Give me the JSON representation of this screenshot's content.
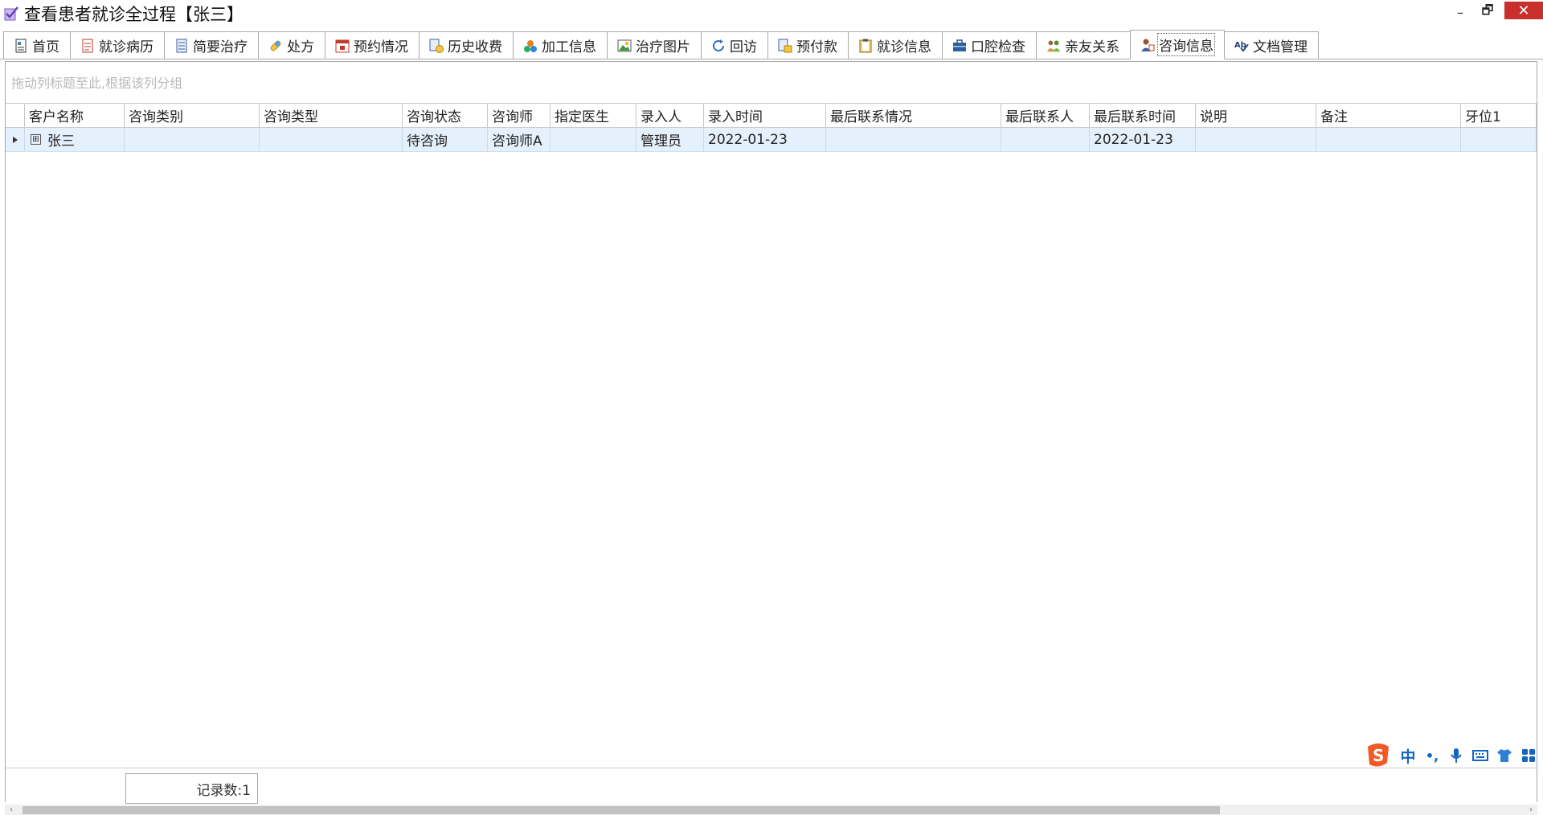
{
  "window": {
    "title": "查看患者就诊全过程【张三】",
    "minimize": "–",
    "restore": "🗗",
    "close": "✕"
  },
  "tabs": [
    {
      "label": "首页",
      "icon": "home-icon"
    },
    {
      "label": "就诊病历",
      "icon": "medical-record-icon"
    },
    {
      "label": "简要治疗",
      "icon": "document-icon"
    },
    {
      "label": "处方",
      "icon": "pill-icon"
    },
    {
      "label": "预约情况",
      "icon": "calendar-icon"
    },
    {
      "label": "历史收费",
      "icon": "billing-icon"
    },
    {
      "label": "加工信息",
      "icon": "processing-icon"
    },
    {
      "label": "治疗图片",
      "icon": "image-icon"
    },
    {
      "label": "回访",
      "icon": "refresh-icon"
    },
    {
      "label": "预付款",
      "icon": "prepayment-icon"
    },
    {
      "label": "就诊信息",
      "icon": "clipboard-icon"
    },
    {
      "label": "口腔检查",
      "icon": "briefcase-icon"
    },
    {
      "label": "亲友关系",
      "icon": "people-icon"
    },
    {
      "label": "咨询信息",
      "icon": "consult-user-icon",
      "active": true
    },
    {
      "label": "文档管理",
      "icon": "spellcheck-icon"
    }
  ],
  "group_panel": {
    "hint": "拖动列标题至此,根据该列分组"
  },
  "grid": {
    "columns": [
      "客户名称",
      "咨询类别",
      "咨询类型",
      "咨询状态",
      "咨询师",
      "指定医生",
      "录入人",
      "录入时间",
      "最后联系情况",
      "最后联系人",
      "最后联系时间",
      "说明",
      "备注",
      "牙位1"
    ],
    "rows": [
      {
        "expander": "⊞",
        "cells": [
          "张三",
          "",
          "",
          "待咨询",
          "咨询师A",
          "",
          "管理员",
          "2022-01-23",
          "",
          "",
          "2022-01-23",
          "",
          "",
          ""
        ]
      }
    ]
  },
  "footer": {
    "record_count": "记录数:1"
  },
  "ime": {
    "mode": "中",
    "punct": "•,",
    "colors": {
      "logo": "#f15a24",
      "icons": "#1565c0"
    }
  }
}
